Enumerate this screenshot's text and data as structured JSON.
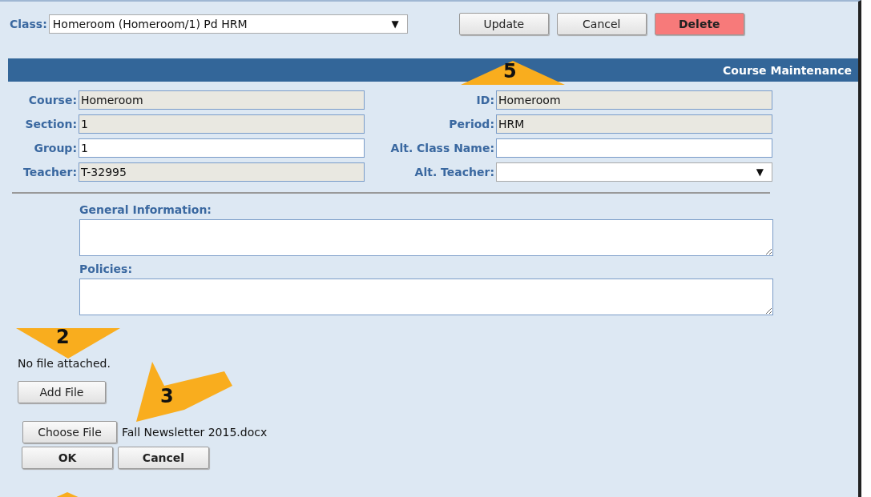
{
  "class_selector": {
    "label": "Class:",
    "value": "Homeroom (Homeroom/1) Pd HRM",
    "arrow": "▼"
  },
  "actions": [
    {
      "label": "Update",
      "kind": "default"
    },
    {
      "label": "Cancel",
      "kind": "default"
    },
    {
      "label": "Delete",
      "kind": "danger"
    }
  ],
  "banner": {
    "title": "Course Maintenance"
  },
  "fields_left": [
    {
      "label": "Course:",
      "value": "Homeroom",
      "disabled": true,
      "kind": "text"
    },
    {
      "label": "Section:",
      "value": "1",
      "disabled": true,
      "kind": "text"
    },
    {
      "label": "Group:",
      "value": "1",
      "disabled": false,
      "kind": "text"
    },
    {
      "label": "Teacher:",
      "value": "T-32995",
      "disabled": true,
      "kind": "text"
    }
  ],
  "fields_right": [
    {
      "label": "ID:",
      "value": "Homeroom",
      "disabled": true,
      "kind": "text"
    },
    {
      "label": "Period:",
      "value": "HRM",
      "disabled": true,
      "kind": "text"
    },
    {
      "label": "Alt. Class Name:",
      "disabled": false,
      "kind": "text"
    },
    {
      "label": "Alt. Teacher:",
      "disabled": false,
      "kind": "select",
      "arrow": "▼"
    }
  ],
  "text_areas": [
    {
      "label": "General Information:"
    },
    {
      "label": "Policies:"
    }
  ],
  "attachments": {
    "status": "No file attached.",
    "add_button": "Add File",
    "choose_button": "Choose File",
    "file_name": "Fall Newsletter 2015.docx",
    "ok_button": "OK",
    "cancel_button": "Cancel"
  },
  "annotations": [
    {
      "number": "5"
    },
    {
      "number": "2"
    },
    {
      "number": "3"
    }
  ]
}
